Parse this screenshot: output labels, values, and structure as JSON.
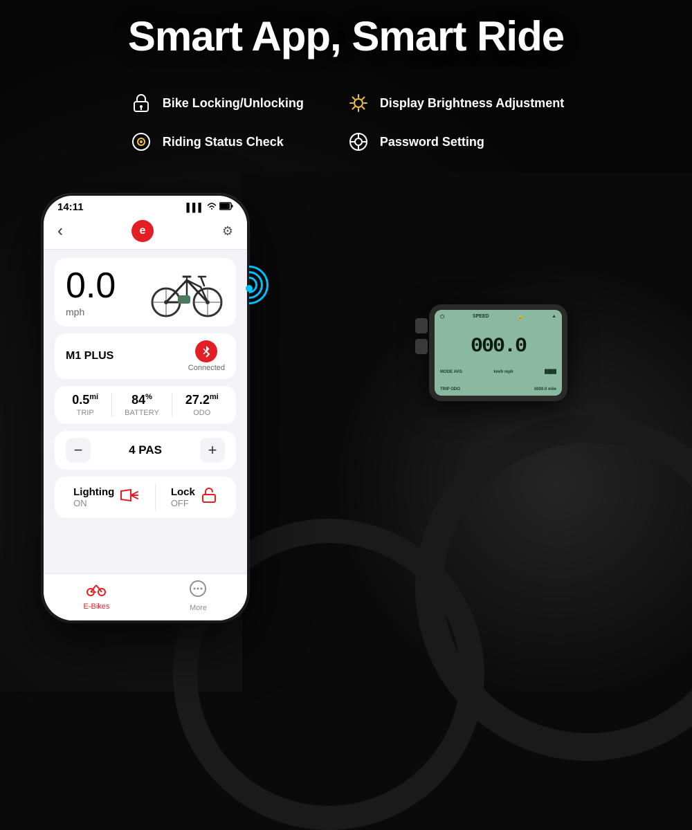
{
  "page": {
    "title": "Smart App, Smart Ride",
    "background_color": "#0a0a0a"
  },
  "features": {
    "col1": [
      {
        "icon": "🔒",
        "text": "Bike Locking/Unlocking",
        "id": "bike-locking"
      },
      {
        "icon": "🎯",
        "text": "Riding Status Check",
        "id": "riding-status"
      }
    ],
    "col2": [
      {
        "icon": "☀️",
        "text": "Display Brightness Adjustment",
        "id": "brightness"
      },
      {
        "icon": "⚙️",
        "text": "Password Setting",
        "id": "password"
      }
    ]
  },
  "phone": {
    "status_bar": {
      "time": "14:11",
      "signal": "▌▌▌",
      "wifi": "wifi",
      "battery": "🔋"
    },
    "nav": {
      "back": "‹",
      "logo": "e",
      "gear": "⚙"
    },
    "speed": {
      "value": "0.0",
      "unit": "mph"
    },
    "bike_name": "M1 PLUS",
    "connection": {
      "status": "Connected",
      "icon": "bluetooth"
    },
    "stats": [
      {
        "value": "0.5",
        "unit": "mi",
        "label": "TRIP"
      },
      {
        "value": "84",
        "unit": "%",
        "label": "BATTERY"
      },
      {
        "value": "27.2",
        "unit": "mi",
        "label": "ODO"
      }
    ],
    "pas": {
      "minus": "−",
      "value": "4 PAS",
      "plus": "+"
    },
    "controls": [
      {
        "label": "Lighting",
        "status": "ON",
        "icon": "💡",
        "id": "lighting"
      },
      {
        "label": "Lock",
        "status": "OFF",
        "icon": "🔓",
        "id": "lock"
      }
    ],
    "bottom_nav": [
      {
        "icon": "🚲",
        "label": "E-Bikes",
        "active": true
      },
      {
        "icon": "💬",
        "label": "More",
        "active": false
      }
    ]
  },
  "computer": {
    "speed_display": "000.0",
    "unit_top": "SPEED",
    "mode_label": "MODE AVG",
    "trip_odo": "TRIP ODO"
  },
  "wifi_signal": {
    "color": "#00bfff"
  }
}
